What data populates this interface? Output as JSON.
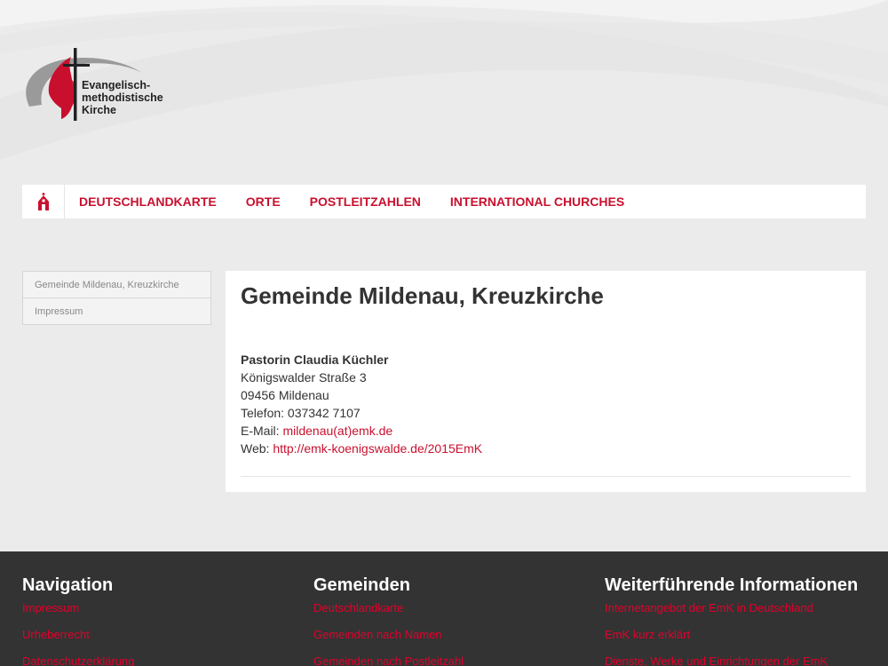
{
  "colors": {
    "accent": "#c8102e",
    "footer_bg": "#333333",
    "footer_link": "#e3002b",
    "page_bg": "#ebebeb"
  },
  "logo": {
    "line1": "Evangelisch-",
    "line2": "methodistische",
    "line3": "Kirche",
    "icon": "cross-flame-logo"
  },
  "nav": {
    "home_icon": "church-icon",
    "items": [
      {
        "label": "Deutschlandkarte"
      },
      {
        "label": "Orte"
      },
      {
        "label": "Postleitzahlen"
      },
      {
        "label": "International Churches"
      }
    ]
  },
  "sidebar": {
    "items": [
      {
        "label": "Gemeinde Mildenau, Kreuzkirche"
      },
      {
        "label": "Impressum"
      }
    ]
  },
  "main": {
    "title": "Gemeinde Mildenau, Kreuzkirche",
    "contact_name": "Pastorin Claudia Küchler",
    "street": "Königswalder Straße 3",
    "city": "09456 Mildenau",
    "phone": "Telefon: 037342 7107",
    "email_label": "E-Mail:",
    "email": "mildenau(at)emk.de",
    "web_label": "Web:",
    "web": "http://emk-koenigswalde.de/2015EmK"
  },
  "footer": {
    "columns": [
      {
        "title": "Navigation",
        "links": [
          "Impressum",
          "Urheberrecht",
          "Datenschutzerklärung"
        ]
      },
      {
        "title": "Gemeinden",
        "links": [
          "Deutschlandkarte",
          "Gemeinden nach Namen",
          "Gemeinden nach Postleitzahl"
        ]
      },
      {
        "title": "Weiterführende Informationen",
        "links": [
          "Internetangebot der EmK in Deutschland",
          "EmK kurz erklärt",
          "Dienste, Werke und Einrichtungen der EmK"
        ]
      }
    ]
  }
}
